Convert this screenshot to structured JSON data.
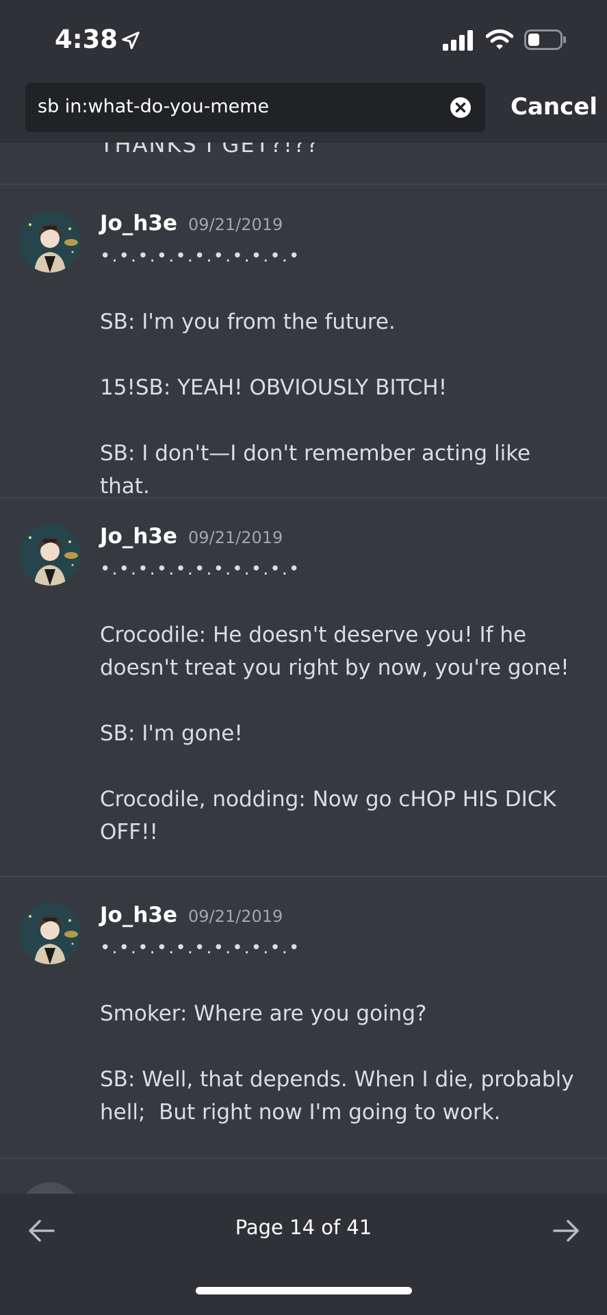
{
  "status_bar": {
    "time": "4:38",
    "icons": [
      "location-arrow-icon",
      "cell-signal-icon",
      "wifi-icon",
      "battery-icon"
    ]
  },
  "search": {
    "query": "sb in:what-do-you-meme",
    "cancel_label": "Cancel"
  },
  "partial_top_message": "THANKS I GET?!??",
  "messages": [
    {
      "author": "Jo_h3e",
      "timestamp": "09/21/2019",
      "lines": [
        "•.•.•.•.•.•.•.•.•.•.•",
        "",
        "SB: I'm you from the future.",
        "",
        "15!SB: YEAH! OBVIOUSLY BITCH!",
        "",
        "SB: I don't—I don't remember acting like that."
      ]
    },
    {
      "author": "Jo_h3e",
      "timestamp": "09/21/2019",
      "lines": [
        "•.•.•.•.•.•.•.•.•.•.•",
        "",
        "Crocodile: He doesn't deserve you! If he",
        "doesn't treat you right by now, you're gone!",
        "",
        "SB: I'm gone!",
        "",
        "Crocodile, nodding: Now go cHOP HIS DICK",
        "OFF!!"
      ]
    },
    {
      "author": "Jo_h3e",
      "timestamp": "09/21/2019",
      "lines": [
        "•.•.•.•.•.•.•.•.•.•.•",
        "",
        "Smoker: Where are you going?",
        "",
        "SB: Well, that depends. When I die, probably",
        "hell;  But right now I'm going to work."
      ]
    }
  ],
  "pagination": {
    "label": "Page 14 of 41"
  },
  "colors": {
    "background": "#36393f",
    "header": "#2f3136",
    "search_field": "#202225",
    "divider": "#42454a"
  }
}
